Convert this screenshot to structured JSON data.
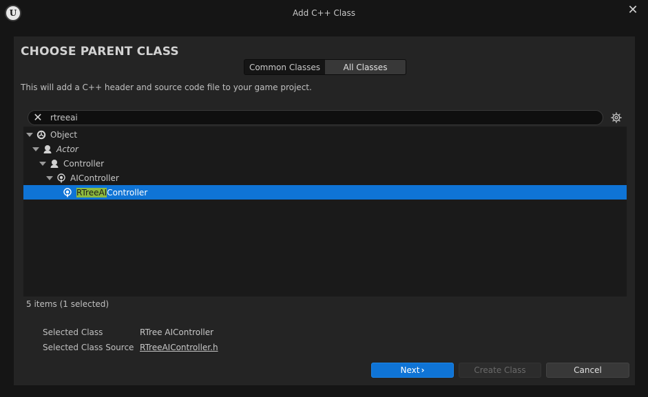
{
  "window": {
    "title": "Add C++ Class",
    "logo_icon": "unreal-engine-logo-icon",
    "close_icon": "close-icon"
  },
  "dialog": {
    "heading": "CHOOSE PARENT CLASS",
    "tabs": [
      {
        "label": "Common Classes",
        "active": false
      },
      {
        "label": "All Classes",
        "active": true
      }
    ],
    "description": "This will add a C++ header and source code file to your game project.",
    "search": {
      "value": "rtreeai",
      "clear_icon": "clear-x-icon",
      "settings_icon": "gear-icon"
    },
    "tree": [
      {
        "label": "Object",
        "depth": 0,
        "expandable": true,
        "italic": false,
        "icon": "object-class-icon"
      },
      {
        "label": "Actor",
        "depth": 1,
        "expandable": true,
        "italic": true,
        "icon": "actor-class-icon"
      },
      {
        "label": "Controller",
        "depth": 2,
        "expandable": true,
        "italic": false,
        "icon": "controller-class-icon"
      },
      {
        "label": "AIController",
        "depth": 3,
        "expandable": true,
        "italic": false,
        "icon": "ai-controller-class-icon"
      },
      {
        "label_match": "RTreeAI",
        "label_rest": "Controller",
        "depth": 4,
        "expandable": false,
        "selected": true,
        "icon": "ai-controller-class-icon"
      }
    ],
    "count_text": "5 items (1 selected)",
    "selected_class_label": "Selected Class",
    "selected_class_value": "RTree AIController",
    "selected_source_label": "Selected Class Source",
    "selected_source_value": "RTreeAIController.h",
    "buttons": {
      "next": "Next",
      "next_icon": "chevron-right-icon",
      "create": "Create Class",
      "cancel": "Cancel"
    }
  },
  "colors": {
    "accent": "#0f74d6",
    "search_highlight": "#8dbb3f",
    "panel": "#242424",
    "tree_bg": "#1a1a1a"
  }
}
